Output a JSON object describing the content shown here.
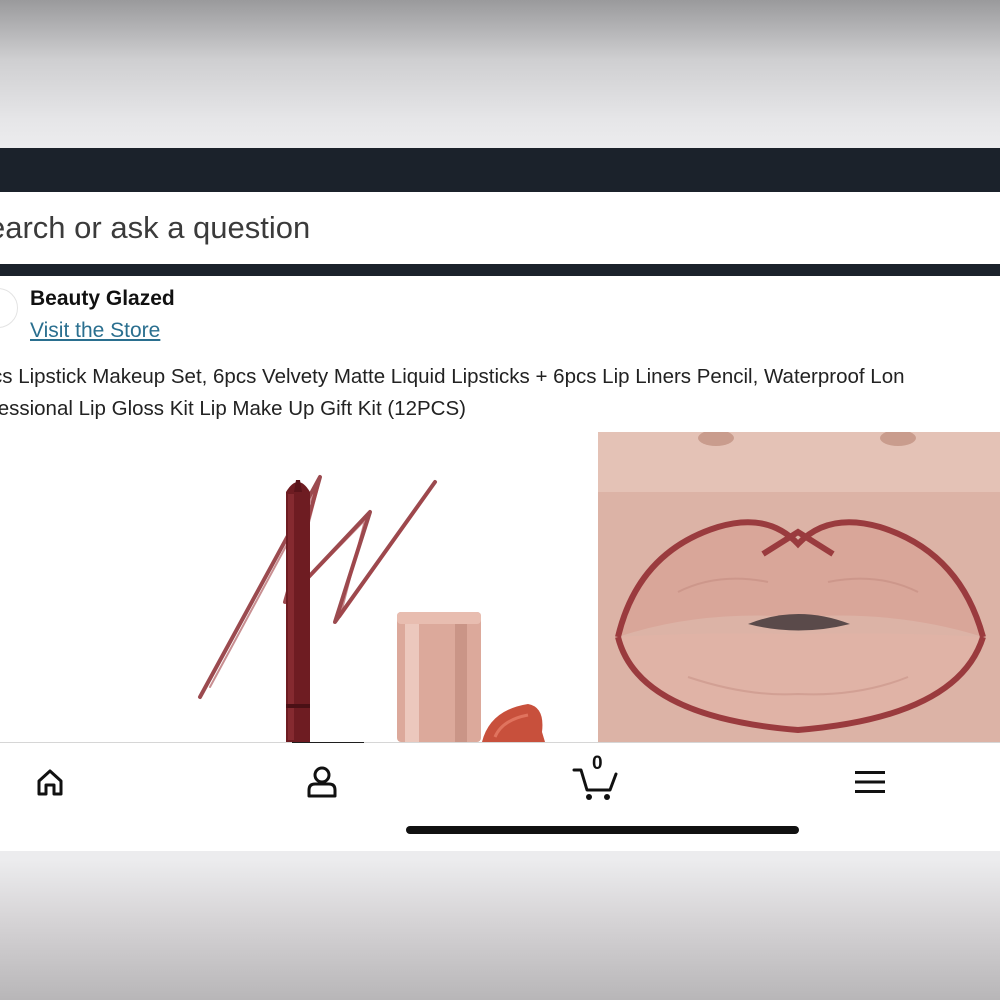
{
  "search": {
    "placeholder": "earch or ask a question"
  },
  "store": {
    "name": "Beauty Glazed",
    "link_label": "Visit the Store"
  },
  "product": {
    "title_line_1": "cs Lipstick Makeup Set, 6pcs Velvety Matte Liquid Lipsticks + 6pcs Lip Liners Pencil, Waterproof Lon",
    "title_line_2": "fessional Lip Gloss Kit Lip Make Up Gift Kit (12PCS)",
    "images": [
      {
        "name": "lip-liner-pencil-and-lipstick"
      },
      {
        "name": "lined-lips-closeup"
      }
    ]
  },
  "bottom_nav": {
    "items": [
      {
        "icon": "home-icon"
      },
      {
        "icon": "account-icon",
        "selected": true
      },
      {
        "icon": "cart-icon"
      },
      {
        "icon": "menu-icon"
      }
    ],
    "cart_count": "0"
  },
  "colors": {
    "header_bg": "#1b222b",
    "link": "#2a6f8f",
    "liner": "#7a1e22",
    "lipstick_case": "#d9a898",
    "lip": "#d9a699"
  }
}
